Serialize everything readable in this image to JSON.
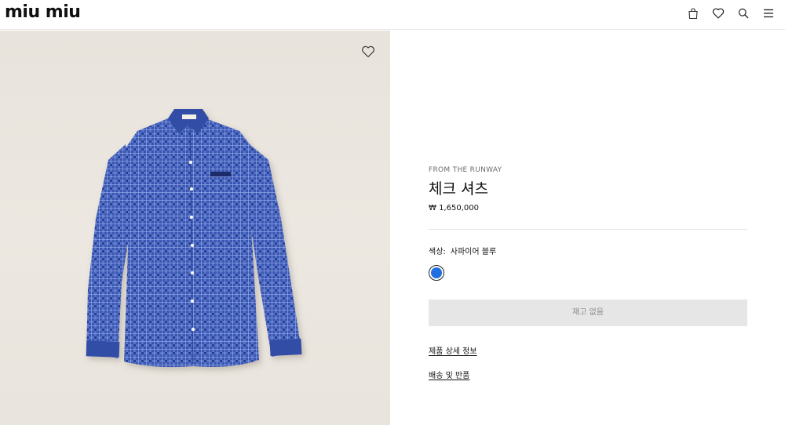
{
  "brand": {
    "logo_text": "miu miu"
  },
  "header": {
    "icons": [
      "bag-icon",
      "heart-icon",
      "search-icon",
      "menu-icon"
    ]
  },
  "gallery": {
    "favorite_icon": "heart-icon",
    "image_subject": "blue check shirt"
  },
  "product": {
    "eyebrow": "FROM THE RUNWAY",
    "name": "체크 셔츠",
    "price": "₩ 1,650,000",
    "color_label": "색상:",
    "color_value": "사파이어 블루",
    "swatch_color": "#1f6fe0",
    "stock_button": "재고 없음",
    "links": {
      "details": "제품 상세 정보",
      "shipping": "배송 및 반품"
    }
  }
}
